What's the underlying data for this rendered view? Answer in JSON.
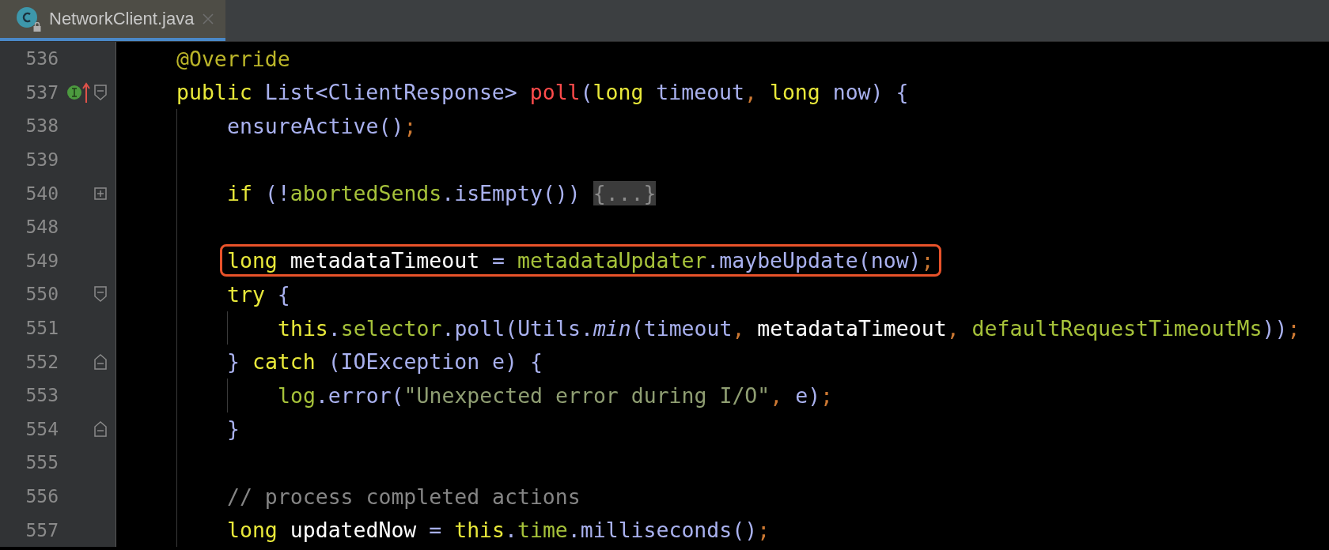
{
  "tabs": [
    {
      "title": "NetworkClient.java",
      "selected": true,
      "read_only": true
    }
  ],
  "lines": [
    {
      "number": "536",
      "kind": "member",
      "tokens": [
        {
          "kind": "annotation",
          "text": "@Override"
        }
      ]
    },
    {
      "number": "537",
      "kind": "member",
      "markers": [
        {
          "kind": "implementation"
        },
        {
          "kind": "override"
        }
      ],
      "fold": {
        "kind": "open"
      },
      "tokens": [
        {
          "kind": "keyword",
          "text": "public "
        },
        {
          "kind": "type",
          "text": "List<ClientResponse> "
        },
        {
          "kind": "declaration",
          "text": "poll"
        },
        {
          "kind": "plain",
          "text": "("
        },
        {
          "kind": "keyword",
          "text": "long "
        },
        {
          "kind": "plain",
          "text": "timeout"
        },
        {
          "kind": "punct",
          "text": ", "
        },
        {
          "kind": "keyword",
          "text": "long "
        },
        {
          "kind": "plain",
          "text": "now) {"
        }
      ]
    },
    {
      "number": "538",
      "kind": "method",
      "tokens": [
        {
          "kind": "plain",
          "text": "ensureActive()"
        },
        {
          "kind": "punct",
          "text": ";"
        }
      ]
    },
    {
      "number": "539",
      "kind": "method"
    },
    {
      "number": "540",
      "kind": "method",
      "fold": {
        "kind": "collapsed"
      },
      "tokens": [
        {
          "kind": "keyword",
          "text": "if "
        },
        {
          "kind": "plain",
          "text": "(!"
        },
        {
          "kind": "field",
          "text": "abortedSends"
        },
        {
          "kind": "plain",
          "text": ".isEmpty()) "
        },
        {
          "kind": "folded",
          "text": "{...}"
        }
      ]
    },
    {
      "number": "548",
      "kind": "method"
    },
    {
      "number": "549",
      "kind": "method",
      "highlighted": true,
      "tokens": [
        {
          "kind": "keyword",
          "text": "long "
        },
        {
          "kind": "local",
          "text": "metadataTimeout"
        },
        {
          "kind": "plain",
          "text": " = "
        },
        {
          "kind": "field",
          "text": "metadataUpdater"
        },
        {
          "kind": "plain",
          "text": ".maybeUpdate(now)"
        },
        {
          "kind": "punct",
          "text": ";"
        }
      ]
    },
    {
      "number": "550",
      "kind": "method",
      "fold": {
        "kind": "open"
      },
      "tokens": [
        {
          "kind": "keyword",
          "text": "try "
        },
        {
          "kind": "plain",
          "text": "{"
        }
      ]
    },
    {
      "number": "551",
      "kind": "block",
      "tokens": [
        {
          "kind": "keyword",
          "text": "this"
        },
        {
          "kind": "plain",
          "text": "."
        },
        {
          "kind": "field",
          "text": "selector"
        },
        {
          "kind": "plain",
          "text": ".poll(Utils."
        },
        {
          "kind": "static",
          "text": "min"
        },
        {
          "kind": "plain",
          "text": "(timeout"
        },
        {
          "kind": "punct",
          "text": ", "
        },
        {
          "kind": "local",
          "text": "metadataTimeout"
        },
        {
          "kind": "punct",
          "text": ", "
        },
        {
          "kind": "field",
          "text": "defaultRequestTimeoutMs"
        },
        {
          "kind": "plain",
          "text": "))"
        },
        {
          "kind": "punct",
          "text": ";"
        }
      ]
    },
    {
      "number": "552",
      "kind": "method",
      "fold": {
        "kind": "close"
      },
      "tokens": [
        {
          "kind": "plain",
          "text": "} "
        },
        {
          "kind": "keyword",
          "text": "catch "
        },
        {
          "kind": "plain",
          "text": "(IOException e) {"
        }
      ]
    },
    {
      "number": "553",
      "kind": "block",
      "tokens": [
        {
          "kind": "field",
          "text": "log"
        },
        {
          "kind": "plain",
          "text": ".error("
        },
        {
          "kind": "string",
          "text": "\"Unexpected error during I/O\""
        },
        {
          "kind": "punct",
          "text": ", "
        },
        {
          "kind": "plain",
          "text": "e)"
        },
        {
          "kind": "punct",
          "text": ";"
        }
      ]
    },
    {
      "number": "554",
      "kind": "method",
      "fold": {
        "kind": "close"
      },
      "tokens": [
        {
          "kind": "plain",
          "text": "}"
        }
      ]
    },
    {
      "number": "555",
      "kind": "method"
    },
    {
      "number": "556",
      "kind": "method",
      "tokens": [
        {
          "kind": "comment",
          "text": "// process completed actions"
        }
      ]
    },
    {
      "number": "557",
      "kind": "method",
      "tokens": [
        {
          "kind": "keyword",
          "text": "long "
        },
        {
          "kind": "local",
          "text": "updatedNow"
        },
        {
          "kind": "plain",
          "text": " = "
        },
        {
          "kind": "keyword",
          "text": "this"
        },
        {
          "kind": "plain",
          "text": "."
        },
        {
          "kind": "field",
          "text": "time"
        },
        {
          "kind": "plain",
          "text": ".milliseconds()"
        },
        {
          "kind": "punct",
          "text": ";"
        }
      ]
    }
  ]
}
